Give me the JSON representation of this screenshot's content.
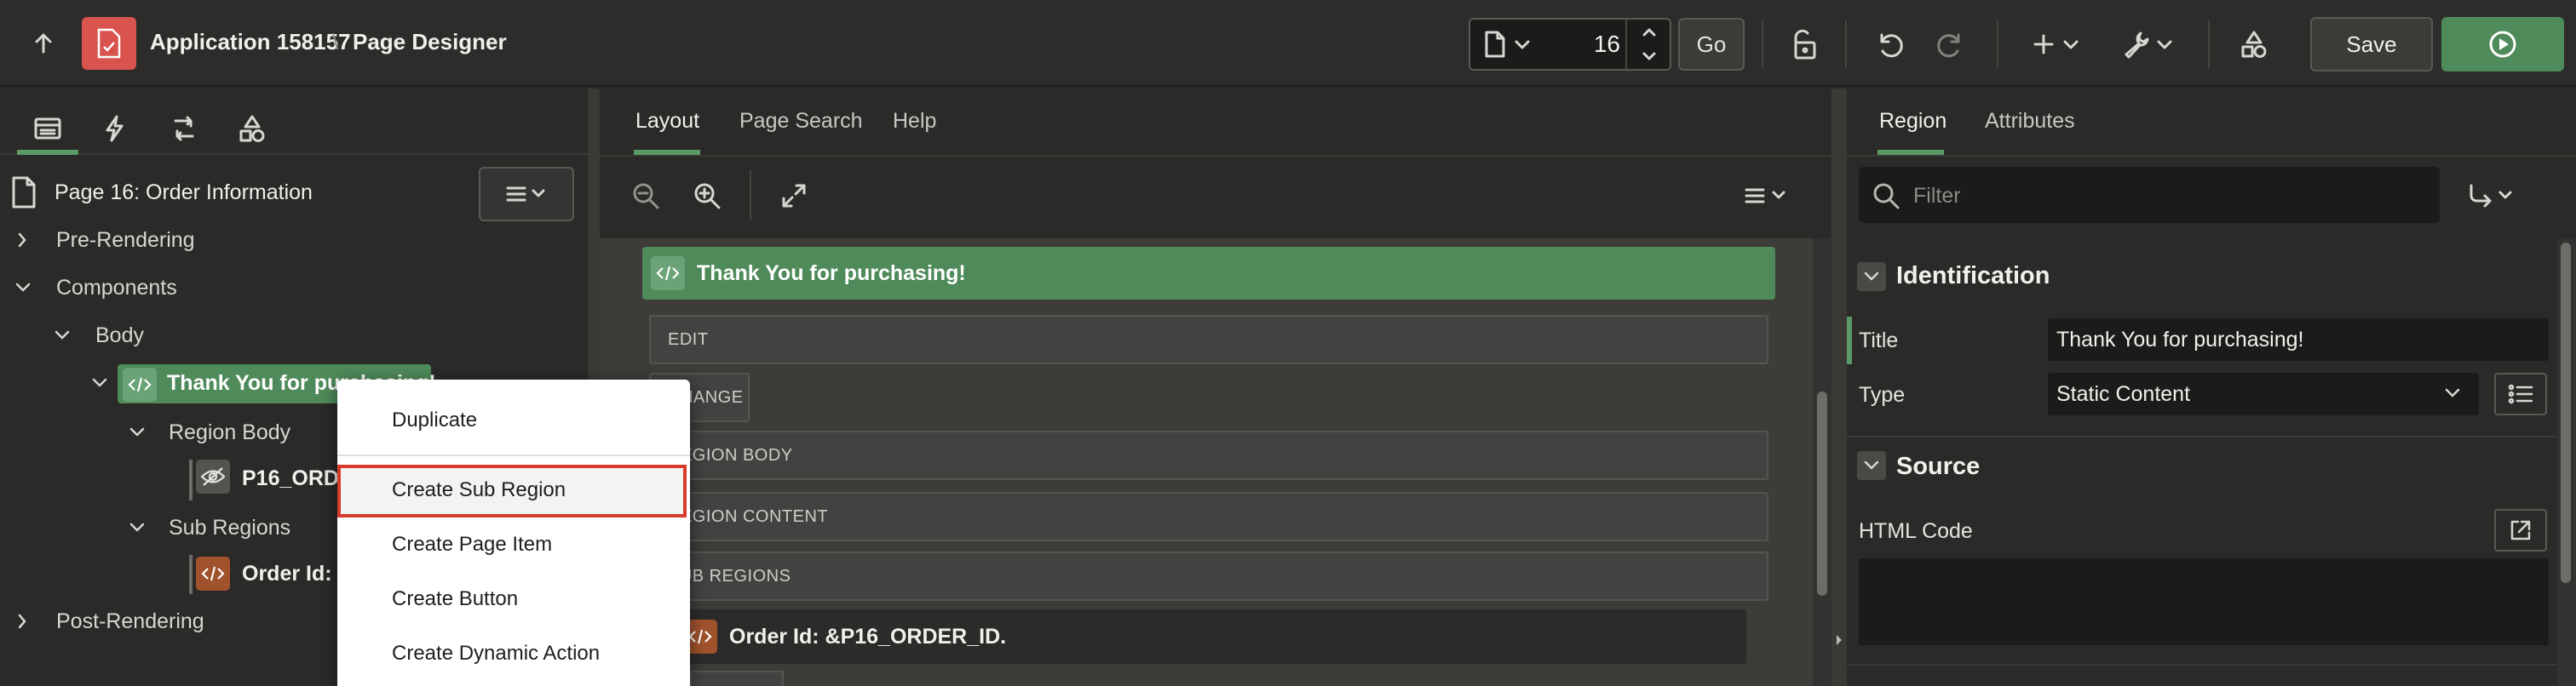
{
  "header": {
    "app_title": "Application 158157",
    "separator": "\\",
    "page_title": "Page Designer",
    "page_number": "16",
    "go_label": "Go",
    "save_label": "Save"
  },
  "left_panel": {
    "page_node": "Page 16: Order Information",
    "tree": {
      "pre_rendering": "Pre-Rendering",
      "components": "Components",
      "body": "Body",
      "thanks_region": "Thank You for purchasing!",
      "region_body": "Region Body",
      "item_p16": "P16_ORDER_ID",
      "sub_regions": "Sub Regions",
      "order_region": "Order Id: &P16_ORDER_ID.",
      "post_rendering": "Post-Rendering"
    }
  },
  "context_menu": {
    "items": [
      "Duplicate",
      "Create Sub Region",
      "Create Page Item",
      "Create Button",
      "Create Dynamic Action"
    ],
    "selected": "Create Sub Region"
  },
  "center_panel": {
    "tabs": [
      "Layout",
      "Page Search",
      "Help"
    ],
    "active_tab": "Layout",
    "region_title": "Thank You for purchasing!",
    "drop_zones": [
      "EDIT",
      "CHANGE",
      "REGION BODY",
      "REGION CONTENT",
      "SUB REGIONS"
    ],
    "sub_region_title": "Order Id: &P16_ORDER_ID."
  },
  "right_panel": {
    "tabs": [
      "Region",
      "Attributes"
    ],
    "active_tab": "Region",
    "filter_placeholder": "Filter",
    "identification": {
      "heading": "Identification",
      "title_label": "Title",
      "title_value": "Thank You for purchasing!",
      "type_label": "Type",
      "type_value": "Static Content"
    },
    "source": {
      "heading": "Source",
      "html_code_label": "HTML Code",
      "html_code_value": ""
    }
  },
  "colors": {
    "accent_green": "#4f8a5a",
    "app_icon_red": "#d9534f",
    "highlight_red": "#d73b2c"
  }
}
